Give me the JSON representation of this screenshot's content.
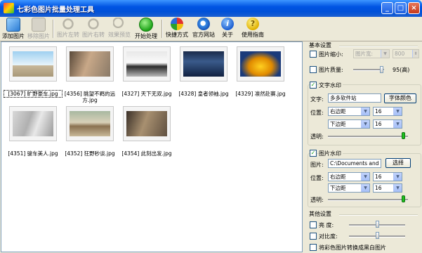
{
  "window": {
    "title": "七彩色图片批量处理工具"
  },
  "toolbar": [
    {
      "label": "添加图片",
      "icon": "add-image-icon",
      "disabled": false
    },
    {
      "label": "移除图片",
      "icon": "remove-image-icon",
      "disabled": true
    },
    {
      "label": "图片左转",
      "icon": "rotate-left-icon",
      "disabled": true
    },
    {
      "label": "图片右转",
      "icon": "rotate-right-icon",
      "disabled": true
    },
    {
      "label": "效果预览",
      "icon": "preview-magnifier-icon",
      "disabled": true
    },
    {
      "label": "开始处理",
      "icon": "play-icon",
      "disabled": false
    },
    {
      "label": "快捷方式",
      "icon": "shortcut-icon",
      "disabled": false
    },
    {
      "label": "官方网站",
      "icon": "ie-icon",
      "disabled": false
    },
    {
      "label": "关于",
      "icon": "info-icon",
      "disabled": false
    },
    {
      "label": "使用指南",
      "icon": "help-icon",
      "disabled": false
    }
  ],
  "images": [
    {
      "caption": "[3067] 旷野豪车.jpg",
      "selected": true
    },
    {
      "caption": "[4356] 眺望不羁的远方.jpg",
      "selected": false
    },
    {
      "caption": "[4327] 天下无双.jpg",
      "selected": false
    },
    {
      "caption": "[4328] 皇者领袖.jpg",
      "selected": false
    },
    {
      "caption": "[4329] 凛然赴赛.jpg",
      "selected": false
    },
    {
      "caption": "[4351] 骏车美人.jpg",
      "selected": false
    },
    {
      "caption": "[4352] 狂野秒谈.jpg",
      "selected": false
    },
    {
      "caption": "[4354] 此刻出发.jpg",
      "selected": false
    }
  ],
  "settings": {
    "basic": {
      "title": "基本设置",
      "resize_label": "图片缩小:",
      "resize_mode": "图片宽:",
      "resize_value": "800",
      "quality_label": "图片质量:",
      "quality_value": "95(高)",
      "resize_checked": false,
      "quality_checked": false
    },
    "text_wm": {
      "title": "文字水印",
      "checked": true,
      "text_label": "文字:",
      "text_value": "多多软件站",
      "font_color_btn": "字体颜色",
      "position_label": "位置:",
      "h_pos": "右边距",
      "h_val": "16",
      "v_pos": "下边距",
      "v_val": "16",
      "opacity_label": "透明:",
      "opacity": 0.95
    },
    "image_wm": {
      "title": "图片水印",
      "checked": true,
      "image_label": "图片:",
      "image_path": "C:\\Documents and S",
      "choose_btn": "选择",
      "position_label": "位置:",
      "h_pos": "右边距",
      "h_val": "16",
      "v_pos": "下边距",
      "v_val": "16",
      "opacity_label": "透明:",
      "opacity": 0.95
    },
    "other": {
      "title": "其他设置",
      "brightness_label": "亮  度:",
      "contrast_label": "对比度:",
      "grayscale_label": "将彩色图片转换成黑白图片"
    }
  }
}
